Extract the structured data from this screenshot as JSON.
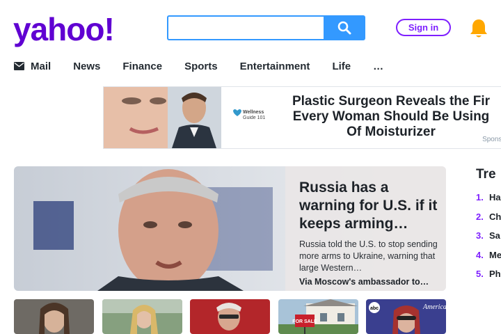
{
  "header": {
    "logo_text": "yahoo!",
    "search_placeholder": "",
    "search_value": "",
    "signin_label": "Sign in"
  },
  "nav": {
    "items": [
      {
        "label": "Mail",
        "icon": "mail-icon"
      },
      {
        "label": "News"
      },
      {
        "label": "Finance"
      },
      {
        "label": "Sports"
      },
      {
        "label": "Entertainment"
      },
      {
        "label": "Life"
      },
      {
        "label": "…"
      }
    ]
  },
  "ad": {
    "logo_text": "Wellness Guide 101",
    "headline": "Plastic Surgeon Reveals the Fir Every Woman Should Be Using Of Moisturizer",
    "headline_lines": [
      "Plastic Surgeon Reveals the Fir",
      "Every Woman Should Be Using",
      "Of Moisturizer"
    ],
    "sponsor": "Sponso"
  },
  "hero": {
    "title": "Russia has a warning for U.S. if it keeps arming…",
    "summary": "Russia told the U.S. to stop sending more arms to Ukraine, warning that large Western…",
    "source": "Via Moscow's ambassador to…"
  },
  "thumbs": [
    {
      "name": "thumb-woman-courtroom"
    },
    {
      "name": "thumb-woman-outdoors"
    },
    {
      "name": "thumb-man-red-seats"
    },
    {
      "name": "thumb-house-for-sale",
      "sign_text": "FOR SALE"
    },
    {
      "name": "thumb-woman-abc",
      "overlay_text": "American",
      "corner_text": "abc"
    }
  ],
  "trending": {
    "title": "Tre",
    "items": [
      {
        "num": "1.",
        "text": "Ha"
      },
      {
        "num": "2.",
        "text": "Ch"
      },
      {
        "num": "3.",
        "text": "Sa"
      },
      {
        "num": "4.",
        "text": "Me"
      },
      {
        "num": "5.",
        "text": "Ph"
      }
    ]
  },
  "colors": {
    "brand_purple": "#6001d2",
    "accent_purple": "#7e1fff",
    "search_blue": "#3399ff",
    "bell_yellow": "#ffa700"
  }
}
